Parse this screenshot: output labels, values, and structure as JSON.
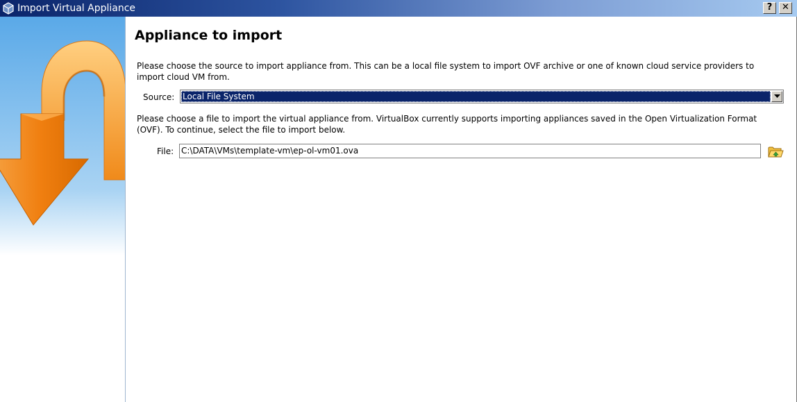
{
  "window": {
    "title": "Import Virtual Appliance",
    "help_button": "?",
    "close_button": "✕"
  },
  "page": {
    "title": "Appliance to import",
    "source_description": "Please choose the source to import appliance from. This can be a local file system to import OVF archive or one of known cloud service providers to import cloud VM from.",
    "file_description": "Please choose a file to import the virtual appliance from. VirtualBox currently supports importing appliances saved in the Open Virtualization Format (OVF). To continue, select the file to import below."
  },
  "source": {
    "label": "Source:",
    "selected": "Local File System"
  },
  "file": {
    "label": "File:",
    "value": "C:\\DATA\\VMs\\template-vm\\ep-ol-vm01.ova"
  },
  "icons": {
    "title_icon": "virtualbox-icon",
    "browse_icon": "folder-open-icon",
    "side_art": "import-arrow-icon",
    "dropdown": "chevron-down-icon"
  },
  "colors": {
    "titlebar_start": "#0a246a",
    "titlebar_end": "#a6caf0",
    "selection": "#0a246a",
    "arrow_orange": "#f28a1c"
  }
}
